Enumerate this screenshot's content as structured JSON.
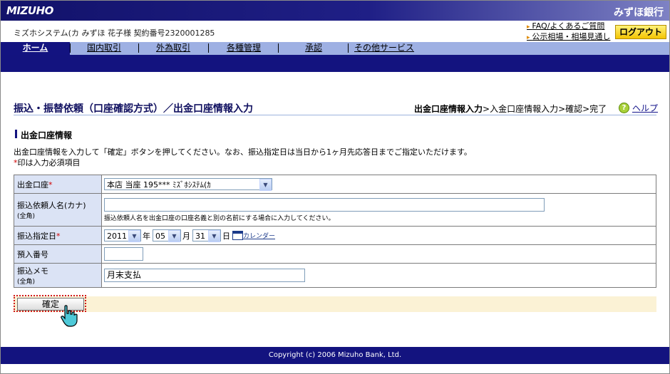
{
  "header": {
    "logo": "MIZUHO",
    "bank_name": "みずほ銀行",
    "user_info": "ミズホシステム(カ  みずほ  花子様  契約番号2320001285",
    "links": [
      "FAQ/よくあるご質問",
      "公示相場・相場見通し"
    ],
    "logout_label": "ログアウト"
  },
  "nav": {
    "items": [
      "ホーム",
      "国内取引",
      "外為取引",
      "各種管理",
      "承認",
      "その他サービス"
    ],
    "active_index": 0
  },
  "page": {
    "title": "振込・振替依頼（口座確認方式）／出金口座情報入力",
    "steps_current": "出金口座情報入力",
    "steps_rest": ">入金口座情報入力>確認>完了",
    "help_label": "ヘルプ",
    "help_icon": "?"
  },
  "section": {
    "title": "出金口座情報",
    "description": "出金口座情報を入力して「確定」ボタンを押してください。なお、振込指定日は当日から1ヶ月先応答日までご指定いただけます。",
    "required_note_mark": "*",
    "required_note": "印は入力必須項目"
  },
  "form": {
    "account_label": "出金口座",
    "account_value": "本店 当座 195*** ﾐｽﾞﾎｼｽﾃﾑ(ｶ",
    "requester_label": "振込依頼人名(カナ)",
    "requester_sub": "(全角)",
    "requester_value": "",
    "requester_note": "振込依頼人名を出金口座の口座名義と別の名前にする場合に入力してください。",
    "date_label": "振込指定日",
    "year_value": "2011",
    "year_unit": "年",
    "month_value": "05",
    "month_unit": "月",
    "day_value": "31",
    "day_unit": "日",
    "calendar_label": "カレンダー",
    "deposit_no_label": "預入番号",
    "deposit_no_value": "",
    "memo_label": "振込メモ",
    "memo_sub": "(全角)",
    "memo_value": "月末支払",
    "required_mark": "*"
  },
  "actions": {
    "confirm_label": "確定"
  },
  "footer": {
    "copyright": "Copyright (c) 2006 Mizuho Bank, Ltd."
  },
  "colors": {
    "navy": "#13137f",
    "nav_light": "#9eb0e3",
    "label_bg": "#dbe3f5",
    "confirm_row_bg": "#fbf2d5",
    "logout_bg": "#f4c400"
  }
}
